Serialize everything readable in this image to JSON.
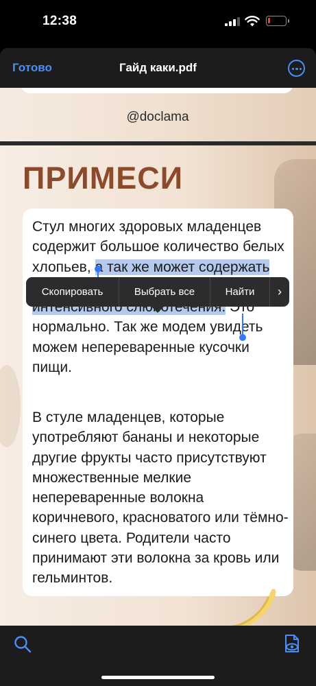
{
  "status_bar": {
    "time": "12:38",
    "signal_icon": "cellular-signal-icon",
    "wifi_icon": "wifi-icon",
    "battery_icon": "battery-low-icon",
    "battery_level": 0.1,
    "battery_color": "#ff3b30"
  },
  "nav": {
    "done_label": "Готово",
    "title": "Гайд каки.pdf",
    "more_icon": "more-ellipsis-icon",
    "accent": "#4a8ff5"
  },
  "doc": {
    "handle": "@doclama",
    "heading": "ПРИМЕСИ",
    "heading_color": "#8b4a2b",
    "p1_before": "Стул многих здоровых младенцев содержит большое количество белых хлопьев, ",
    "p1_selected": "а так же может содержать слизь, особенно во время интенсивного слюнотечения.",
    "p1_after": " Это нормально. Так же модем увидеть можем непереваренные кусочки пищи.",
    "p2": "В стуле младенцев, которые употребляют бананы и некоторые другие фрукты часто присутствуют множественные мелкие непереваренные волокна коричневого, красноватого или тёмно-синего цвета. Родители часто принимают эти волокна за кровь или гельминтов.",
    "selection_color": "#b4c9ec",
    "decoration_icon": "banana-icon"
  },
  "context_menu": {
    "copy": "Скопировать",
    "select_all": "Выбрать все",
    "find": "Найти",
    "next_icon": "chevron-right-icon",
    "next_glyph": "›"
  },
  "toolbar": {
    "search_icon": "search-icon",
    "reader_icon": "document-view-icon"
  }
}
